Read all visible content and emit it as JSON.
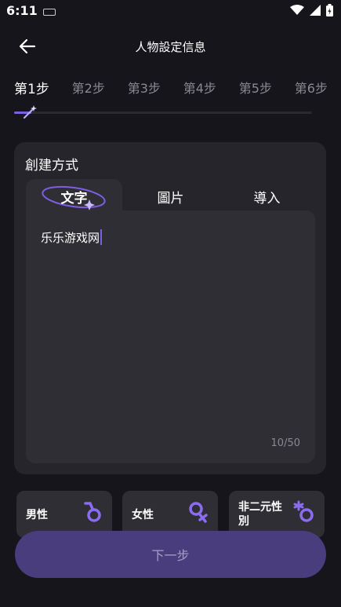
{
  "status": {
    "time": "6:11"
  },
  "header": {
    "title": "人物設定信息",
    "back_icon": "arrow-left-icon"
  },
  "steps": [
    "第1步",
    "第2步",
    "第3步",
    "第4步",
    "第5步",
    "第6步"
  ],
  "current_step": 1,
  "card": {
    "title": "創建方式",
    "tabs": [
      "文字",
      "圖片",
      "導入"
    ],
    "active_tab": "文字",
    "input_value": "乐乐游戏网",
    "counter": "10/50"
  },
  "genders": [
    {
      "label": "男性",
      "icon": "male-icon"
    },
    {
      "label": "女性",
      "icon": "female-icon"
    },
    {
      "label": "非二元性別",
      "icon": "nonbinary-icon"
    }
  ],
  "next_button": {
    "label": "下一步"
  },
  "colors": {
    "accent": "#7c5fe0",
    "background": "#16151b",
    "card": "#26252b",
    "next_bg": "#4a3d7e"
  }
}
